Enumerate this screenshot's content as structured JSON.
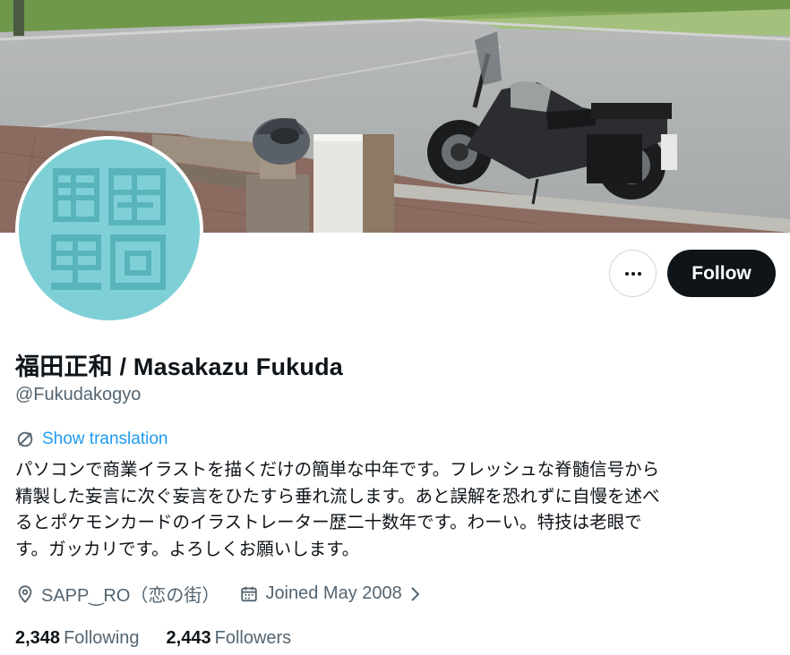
{
  "profile": {
    "display_name": "福田正和 / Masakazu Fukuda",
    "handle": "@Fukudakogyo",
    "show_translation": "Show translation",
    "bio_lines": [
      "パソコンで商業イラストを描くだけの簡単な中年です。フレッシュな脊髄信号から",
      "精製した妄言に次ぐ妄言をひたすら垂れ流します。あと誤解を恐れずに自慢を述べ",
      "るとポケモンカードのイラストレーター歴二十数年です。わーい。特技は老眼で",
      "す。ガッカリです。よろしくお願いします。"
    ],
    "location": "SAPP‿RO（恋の街）",
    "joined": "Joined May 2008",
    "following_count": "2,348",
    "following_label": "Following",
    "followers_count": "2,443",
    "followers_label": "Followers"
  },
  "buttons": {
    "follow": "Follow",
    "more_icon": "more-dots-icon"
  },
  "icons": {
    "translate": "translate-icon",
    "location": "location-pin-icon",
    "calendar": "calendar-icon",
    "chevron": "chevron-right-icon"
  },
  "colors": {
    "accent": "#1d9bf0",
    "primary_text": "#0f1419",
    "secondary_text": "#536471",
    "avatar_bg": "#7fd0d6",
    "follow_button": "#0f1419"
  }
}
